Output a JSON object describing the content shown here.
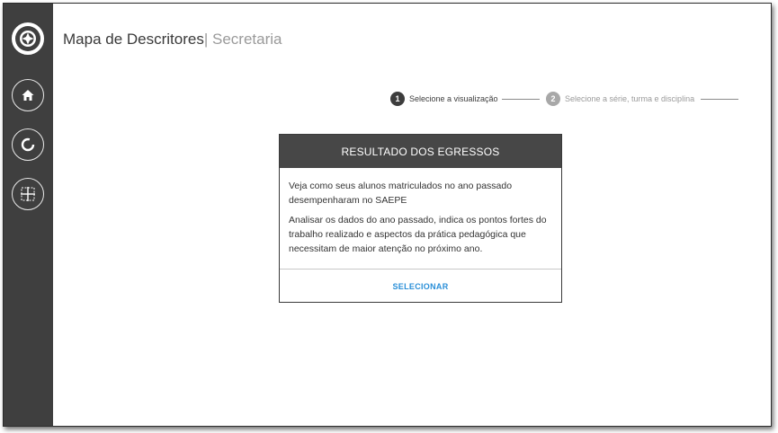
{
  "sidebar": {
    "items": [
      {
        "name": "logo-icon"
      },
      {
        "name": "home-icon"
      },
      {
        "name": "refresh-icon"
      },
      {
        "name": "grid-icon"
      }
    ]
  },
  "header": {
    "title": "Mapa de Descritores",
    "separator": "|",
    "subtitle": "Secretaria"
  },
  "stepper": {
    "steps": [
      {
        "number": "1",
        "label": "Selecione a visualização",
        "state": "active"
      },
      {
        "number": "2",
        "label": "Selecione a série, turma e disciplina",
        "state": "inactive"
      }
    ]
  },
  "card": {
    "title": "RESULTADO DOS EGRESSOS",
    "paragraph1": "Veja como seus alunos matriculados no ano passado desempenharam no SAEPE",
    "paragraph2": "Analisar os dados do ano passado, indica os pontos fortes do trabalho realizado e aspectos da prática pedagógica que necessitam de maior atenção no próximo ano.",
    "action_label": "SELECIONAR"
  },
  "colors": {
    "sidebar_bg": "#3f3f3f",
    "card_header_bg": "#474747",
    "link": "#2a8fd8"
  }
}
